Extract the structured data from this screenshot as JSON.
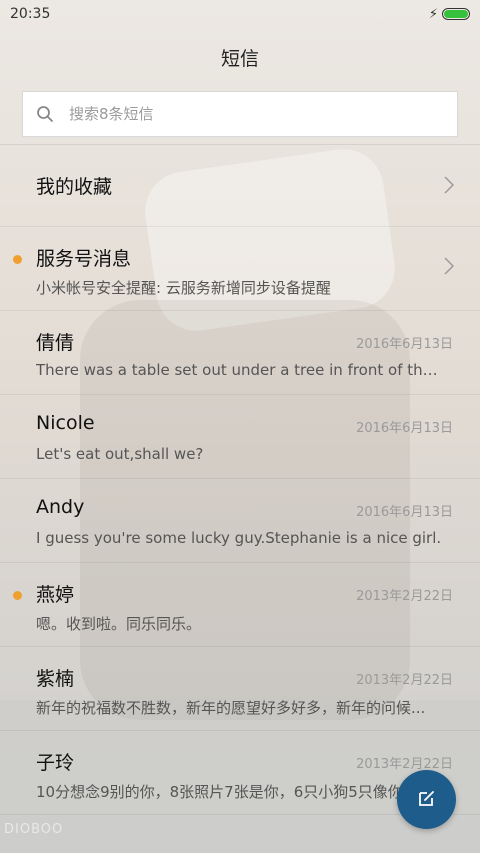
{
  "status": {
    "time": "20:35",
    "battery_fill": 1.0
  },
  "title": "短信",
  "search": {
    "placeholder": "搜索8条短信"
  },
  "favorites": {
    "label": "我的收藏"
  },
  "service": {
    "name": "服务号消息",
    "preview": "小米帐号安全提醒: 云服务新增同步设备提醒"
  },
  "messages": [
    {
      "name": "倩倩",
      "preview": "There was a table set out under a tree in front of the house...",
      "date": "2016年6月13日",
      "unread": false
    },
    {
      "name": "Nicole",
      "preview": "Let's eat out,shall we?",
      "date": "2016年6月13日",
      "unread": false
    },
    {
      "name": "Andy",
      "preview": "I guess you're some lucky guy.Stephanie is a nice girl.",
      "date": "2016年6月13日",
      "unread": false
    },
    {
      "name": "燕婷",
      "preview": "嗯。收到啦。同乐同乐。",
      "date": "2013年2月22日",
      "unread": true
    },
    {
      "name": "紫楠",
      "preview": "新年的祝福数不胜数，新年的愿望好多好多，新年的问候...",
      "date": "2013年2月22日",
      "unread": false
    },
    {
      "name": "子玲",
      "preview": "10分想念9别的你，8张照片7张是你，6只小狗5只像你...",
      "date": "2013年2月22日",
      "unread": false
    }
  ],
  "colors": {
    "unread_dot": "#f0a030",
    "fab": "#1e5c8c",
    "battery": "#36c13c"
  },
  "icons": {
    "fab": "compose-icon",
    "search": "search-icon",
    "chevron": "chevron-right-icon"
  },
  "watermark": "DIOBOO"
}
